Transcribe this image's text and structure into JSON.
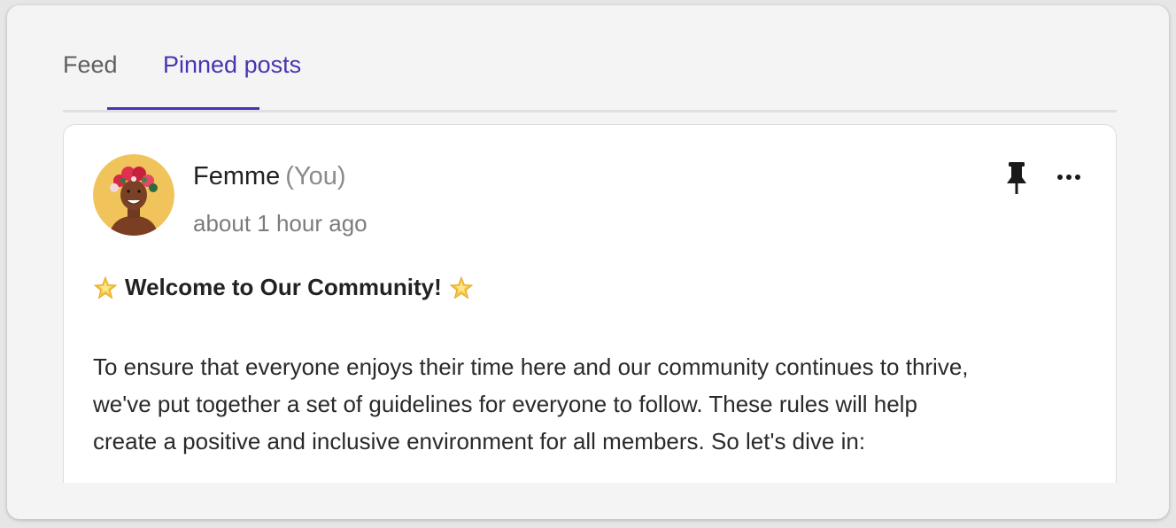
{
  "tabs": {
    "feed_label": "Feed",
    "pinned_label": "Pinned posts",
    "active": "Pinned posts"
  },
  "post": {
    "author": "Femme",
    "author_tag": "(You)",
    "timestamp": "about 1 hour ago",
    "headline": "Welcome to Our Community!",
    "headline_icon": "glowing-star-icon",
    "body_lines": [
      "To ensure that everyone enjoys their time here and our community continues to thrive,",
      "we've put together a set of guidelines for everyone to follow. These rules will help",
      "create a positive and inclusive environment for all members. So let's dive in:"
    ],
    "pin_icon": "pushpin-icon",
    "more_icon": "more-options-icon"
  },
  "colors": {
    "accent": "#4535b0",
    "panel_bg": "#f4f4f4",
    "card_bg": "#ffffff",
    "muted_text": "#7c7c7c"
  }
}
